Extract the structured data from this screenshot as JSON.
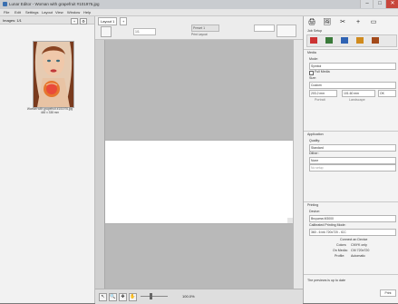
{
  "window": {
    "title": "Lunar Editor - Woman with grapefruit #101976.jpg",
    "close_glyph": "✕",
    "maximize_glyph": "□",
    "minimize_glyph": "–"
  },
  "menu": [
    "File",
    "Edit",
    "Settings",
    "Layout",
    "View",
    "Window",
    "Help"
  ],
  "left_panel": {
    "header": "Images: 1/1",
    "add": "+",
    "gear": "⚙",
    "thumbnail": {
      "filename": "Woman with grapefruit #101976.jpg",
      "size": "448 x 338 mm"
    }
  },
  "toolbar": {
    "tab_label": "Layout 1",
    "tab_add": "+",
    "zoom_value": "1/1",
    "preset": "Preset 1",
    "print_layout": "Print Layout"
  },
  "bottom": {
    "tools": [
      "↖",
      "🔍",
      "✥",
      "✋"
    ],
    "zoom_value": "100.0%"
  },
  "right_panel": {
    "tool_icons": [
      "🖨",
      "🖼",
      "✂",
      "+",
      "▭"
    ],
    "job_setup": "Job Setup",
    "sections": {
      "media": {
        "title": "Media",
        "mode_label": "Mode:",
        "mode_value": "Symbol",
        "full_media": "Full Media",
        "size_label": "Size:",
        "size_value": "Custom",
        "width": "203.2 mm",
        "height": "101.60 mm",
        "portrait": "Portrait",
        "landscape": "Landscape",
        "ok": "OK"
      },
      "application": {
        "title": "Application",
        "quality_label": "Quality:",
        "quality_value": "Standard",
        "dither_label": "Dither:",
        "dither_value": "None",
        "no_setup": "No setup"
      },
      "printing": {
        "title": "Printing",
        "device_label": "Device:",
        "device_value": "Bruyama M3000",
        "calibration_label": "Calibrated Printing Mode:",
        "calibration_value": "360 - 6 ink 720x720 - ICC",
        "connect_label": "Connect an Device",
        "colors_label": "Colors:",
        "colors_value": "CMYK only",
        "on_media_label": "On Media:",
        "on_media_value": "CM 720x720",
        "profile_label": "Profile:",
        "profile_value": "Automatic"
      }
    },
    "status": "The previews is up to date",
    "print_button": "Print"
  }
}
